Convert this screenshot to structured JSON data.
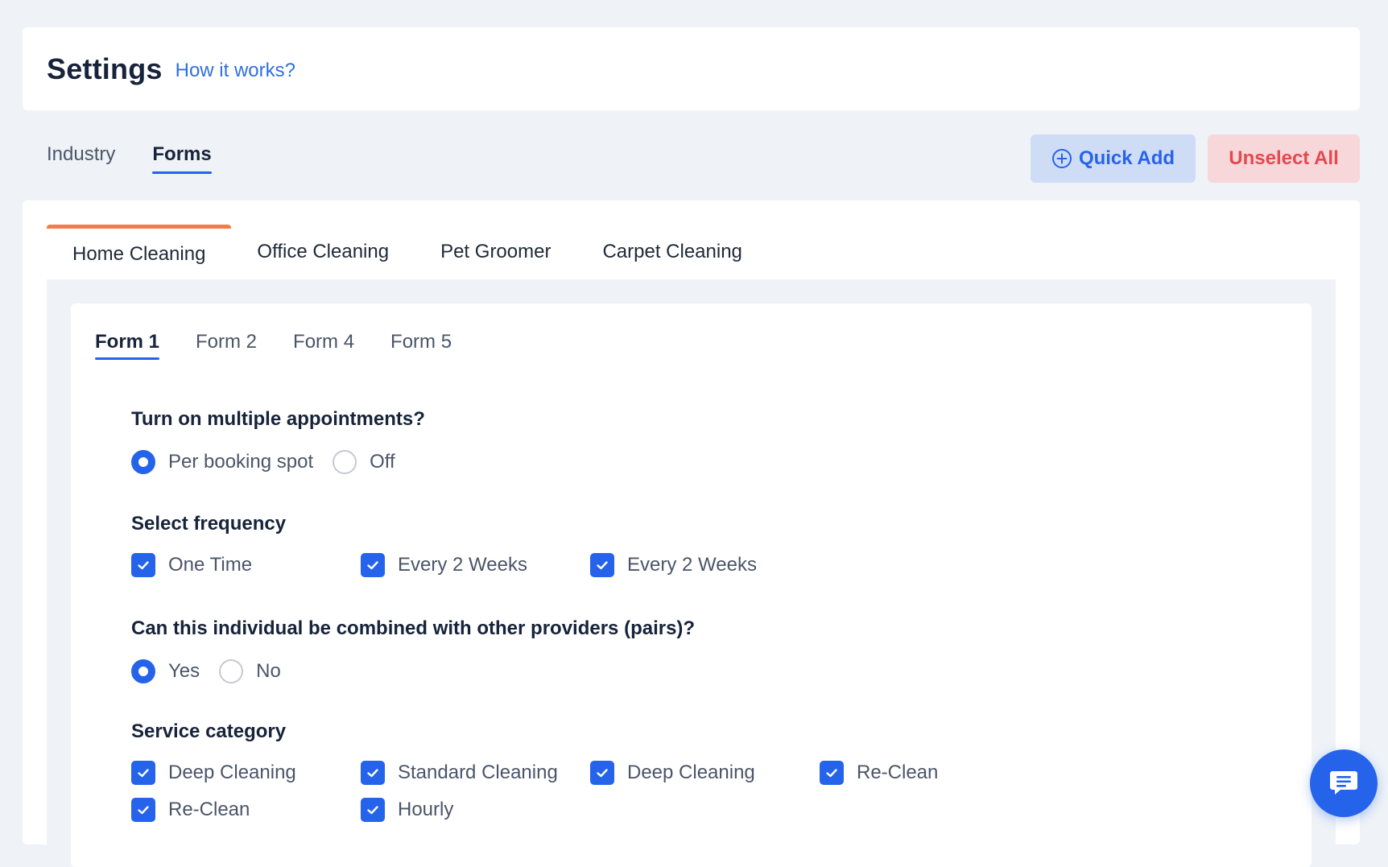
{
  "header": {
    "title": "Settings",
    "help_link": "How it works?"
  },
  "top_tabs": [
    {
      "label": "Industry",
      "active": false
    },
    {
      "label": "Forms",
      "active": true
    }
  ],
  "actions": {
    "quick_add": "Quick Add",
    "unselect_all": "Unselect All"
  },
  "industry_tabs": [
    {
      "label": "Home Cleaning",
      "active": true
    },
    {
      "label": "Office Cleaning",
      "active": false
    },
    {
      "label": "Pet Groomer",
      "active": false
    },
    {
      "label": "Carpet Cleaning",
      "active": false
    }
  ],
  "form_tabs": [
    {
      "label": "Form 1",
      "active": true
    },
    {
      "label": "Form 2",
      "active": false
    },
    {
      "label": "Form 4",
      "active": false
    },
    {
      "label": "Form 5",
      "active": false
    }
  ],
  "multiple_appointments": {
    "question": "Turn on multiple appointments?",
    "options": [
      {
        "label": "Per booking spot",
        "selected": true
      },
      {
        "label": "Off",
        "selected": false
      }
    ]
  },
  "frequency": {
    "question": "Select frequency",
    "options": [
      {
        "label": "One Time",
        "checked": true
      },
      {
        "label": "Every 2 Weeks",
        "checked": true
      },
      {
        "label": "Every 2 Weeks",
        "checked": true
      }
    ]
  },
  "pairs": {
    "question": "Can this individual be combined with other providers (pairs)?",
    "options": [
      {
        "label": "Yes",
        "selected": true
      },
      {
        "label": "No",
        "selected": false
      }
    ]
  },
  "service_category": {
    "question": "Service category",
    "options": [
      {
        "label": "Deep Cleaning",
        "checked": true
      },
      {
        "label": "Standard Cleaning",
        "checked": true
      },
      {
        "label": "Deep Cleaning",
        "checked": true
      },
      {
        "label": "Re-Clean",
        "checked": true
      },
      {
        "label": "Re-Clean",
        "checked": true
      },
      {
        "label": "Hourly",
        "checked": true
      }
    ]
  },
  "colors": {
    "primary": "#2563eb",
    "accent_tab": "#f47c4a",
    "danger": "#e5484d",
    "background": "#eff3f7"
  }
}
